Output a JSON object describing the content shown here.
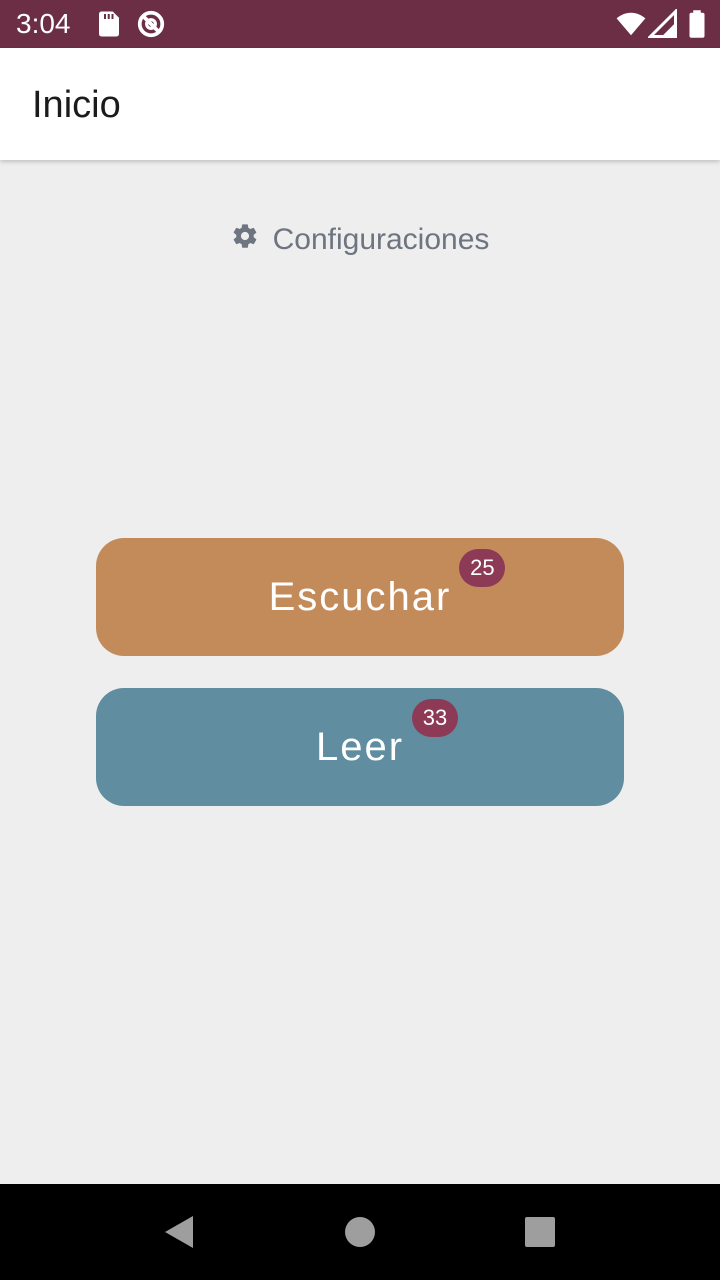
{
  "status_bar": {
    "time": "3:04",
    "icons": [
      "sd-card-icon",
      "no-sync-icon",
      "wifi-icon",
      "signal-icon",
      "battery-icon"
    ],
    "background": "#6b2e44"
  },
  "app_bar": {
    "title": "Inicio"
  },
  "settings": {
    "label": "Configuraciones",
    "icon": "gear-icon"
  },
  "buttons": [
    {
      "label": "Escuchar",
      "badge": "25",
      "color": "#c48b5a"
    },
    {
      "label": "Leer",
      "badge": "33",
      "color": "#608da0"
    }
  ],
  "badge_color": "#8c3a56",
  "nav_bar": {
    "icons": [
      "back-icon",
      "home-icon",
      "recents-icon"
    ]
  }
}
